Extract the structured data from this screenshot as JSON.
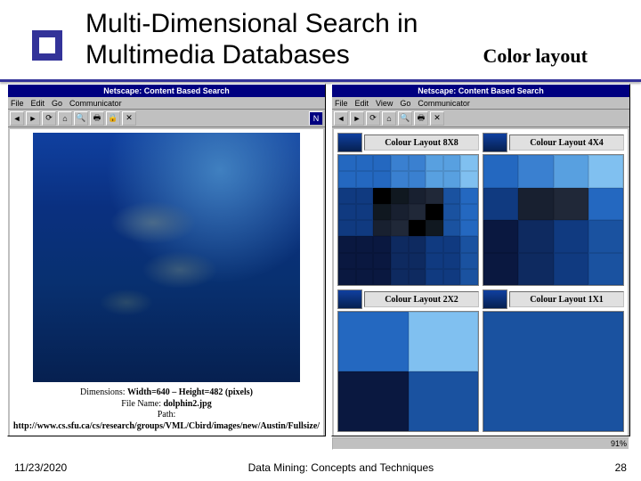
{
  "title_line1": "Multi-Dimensional Search in",
  "title_line2": "Multimedia Databases",
  "subtitle": "Color layout",
  "left_window": {
    "title": "Netscape: Content Based Search",
    "menu": [
      "File",
      "Edit",
      "Go",
      "Communicator"
    ],
    "dimensions_label": "Dimensions:",
    "dimensions_value": "Width=640 – Height=482 (pixels)",
    "filename_label": "File Name:",
    "filename_value": "dolphin2.jpg",
    "path_label": "Path:",
    "path_value": "http://www.cs.sfu.ca/cs/research/groups/VML/Cbird/images/new/Austin/Fullsize/"
  },
  "right_window": {
    "title": "Netscape: Content Based Search",
    "menu": [
      "File",
      "Edit",
      "View",
      "Go",
      "Communicator"
    ],
    "panels": [
      {
        "label": "Colour Layout 8X8"
      },
      {
        "label": "Colour Layout 4X4"
      },
      {
        "label": "Colour Layout 2X2"
      },
      {
        "label": "Colour Layout 1X1"
      }
    ],
    "percent": "91%"
  },
  "footer": {
    "date": "11/23/2020",
    "center": "Data Mining: Concepts and Techniques",
    "page": "28"
  },
  "palette": {
    "blues": [
      "#0a1840",
      "#0e2a60",
      "#103a80",
      "#1a52a0",
      "#2468c0",
      "#3a80d0",
      "#58a0e0",
      "#80c0f0"
    ],
    "darks": [
      "#000000",
      "#101820",
      "#182030",
      "#202838"
    ]
  }
}
